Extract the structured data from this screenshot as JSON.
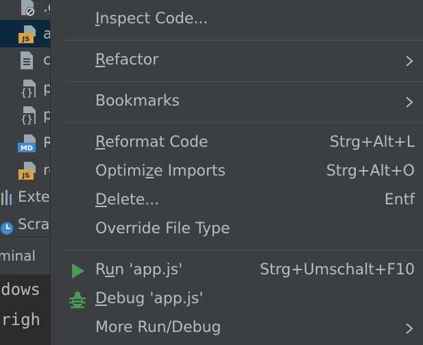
{
  "project_tree": {
    "items": [
      {
        "label": ".g",
        "icon": "ignored-file-icon"
      },
      {
        "label": "a",
        "icon": "js-file-icon",
        "selected": true
      },
      {
        "label": "c",
        "icon": "text-file-icon"
      },
      {
        "label": "p",
        "icon": "json-file-icon"
      },
      {
        "label": "p",
        "icon": "json-file-icon"
      },
      {
        "label": "R",
        "icon": "markdown-file-icon"
      },
      {
        "label": "re",
        "icon": "js-file-icon"
      }
    ],
    "external_libraries_label": "Exter",
    "scratches_label": "Scrat"
  },
  "terminal": {
    "title": "minal:",
    "lines": [
      "dows",
      "yrigh"
    ]
  },
  "context_menu": {
    "items": [
      {
        "key": "inspect",
        "mnemonic": "I",
        "rest": "nspect Code...",
        "pre": ""
      },
      {
        "key": "refactor",
        "mnemonic": "R",
        "rest": "efactor",
        "pre": "",
        "submenu": true
      },
      {
        "key": "bookmarks",
        "label": "Bookmarks",
        "submenu": true
      },
      {
        "key": "reformat",
        "mnemonic": "R",
        "rest": "eformat Code",
        "pre": "",
        "shortcut": "Strg+Alt+L"
      },
      {
        "key": "optimize",
        "pre": "Optimi",
        "mnemonic": "z",
        "rest": "e Imports",
        "shortcut": "Strg+Alt+O"
      },
      {
        "key": "delete",
        "mnemonic": "D",
        "rest": "elete...",
        "pre": "",
        "shortcut": "Entf"
      },
      {
        "key": "override",
        "label": "Override File Type"
      },
      {
        "key": "run",
        "pre": "R",
        "mnemonic": "u",
        "rest": "n 'app.js'",
        "shortcut": "Strg+Umschalt+F10",
        "icon": "run-icon"
      },
      {
        "key": "debug",
        "mnemonic": "D",
        "rest": "ebug 'app.js'",
        "pre": "",
        "icon": "debug-icon"
      },
      {
        "key": "more",
        "label": "More Run/Debug",
        "submenu": true
      }
    ]
  },
  "colors": {
    "menu_bg": "#3c3f41",
    "text": "#bbbbbb",
    "separator": "#515658",
    "run_green": "#499c54",
    "selection": "#0d293e"
  }
}
